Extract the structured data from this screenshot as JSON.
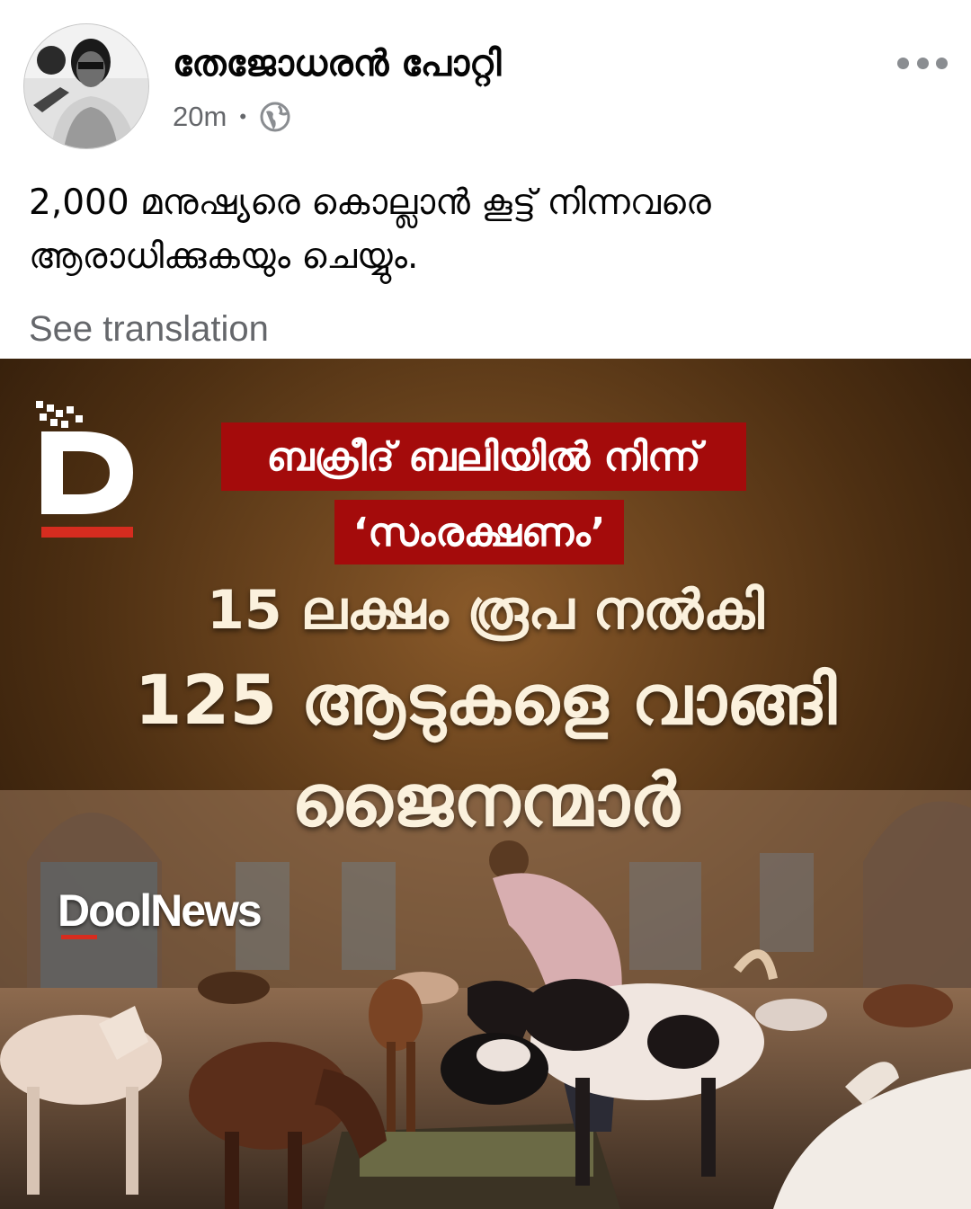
{
  "post": {
    "author": "തേജോധരൻ പോറ്റി",
    "time": "20m",
    "privacy_icon": "globe-icon",
    "text": "2,000 മനുഷ്യരെ കൊല്ലാൻ കൂട്ട് നിന്നവരെ ആരാധിക്കുകയും ചെയ്യും.",
    "see_translation": "See translation",
    "more_icon": "more-horizontal-icon"
  },
  "image": {
    "logo_letter": "D",
    "headline_red_1": "ബക്രീദ് ബലിയിൽ നിന്ന്",
    "headline_red_2": "‘സംരക്ഷണം’",
    "headline_3": "15 ലക്ഷം രൂപ നൽകി",
    "headline_4": "125 ആടുകളെ വാങ്ങി",
    "headline_5": "ജൈനന്മാർ",
    "brand": "DoolNews",
    "colors": {
      "headline_red": "#a40b0b",
      "headline_text": "#fbf1dd",
      "brand_bar": "#d62c1f"
    }
  }
}
